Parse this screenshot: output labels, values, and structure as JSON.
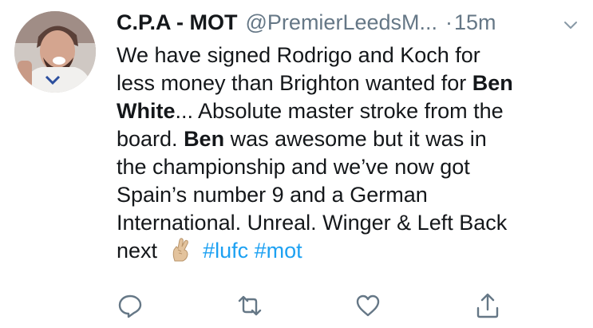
{
  "tweet": {
    "display_name": "C.P.A - MOT",
    "handle": "@PremierLeedsM...",
    "dot": "·",
    "time": "15m",
    "lines": {
      "l1": "We have signed Rodrigo and Koch for",
      "l2": "less money than Brighton wanted for ",
      "l2_bold": "Ben",
      "l3_bold": "White",
      "l3": "... Absolute master stroke from the",
      "l4_pre": "board. ",
      "l4_bold": "Ben",
      "l4": " was awesome but it was in",
      "l5": "the championship and we’ve now got",
      "l6": "Spain’s number 9 and a German",
      "l7": "International. Unreal. Winger & Left Back",
      "l8": "next"
    },
    "hashtags": [
      "#lufc",
      "#mot"
    ]
  },
  "icons": {
    "menu": "chevron-down-icon",
    "reply": "reply-icon",
    "retweet": "retweet-icon",
    "like": "heart-icon",
    "share": "share-icon",
    "emoji": "crossed-fingers-emoji"
  },
  "colors": {
    "text": "#14171a",
    "muted": "#657786",
    "link": "#1da1f2"
  }
}
